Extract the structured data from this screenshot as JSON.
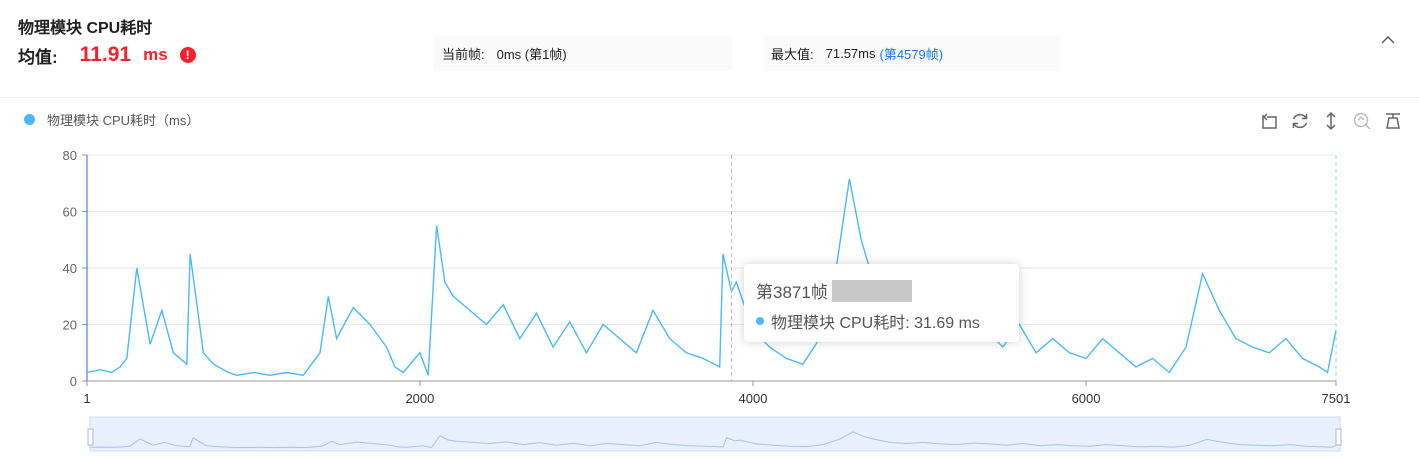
{
  "header": {
    "title": "物理模块 CPU耗时",
    "avg_label": "均值:",
    "avg_value": "11.91",
    "avg_unit": "ms",
    "warn_glyph": "!",
    "current_label": "当前帧:",
    "current_value": "0ms (第1帧)",
    "max_label": "最大值:",
    "max_value": "71.57ms",
    "max_link": "(第4579帧)"
  },
  "colors": {
    "series": "#4db8ff",
    "alert": "#f5222d",
    "link": "#1677ff"
  },
  "icons": [
    "chevron-up-icon",
    "restore-icon",
    "refresh-icon",
    "vertical-arrows-icon",
    "zoom-reset-icon",
    "brush-icon"
  ],
  "tooltip": {
    "title": "第3871帧",
    "series_text": "物理模块 CPU耗时: 31.69 ms"
  },
  "chart_data": {
    "type": "line",
    "legend": "物理模块 CPU耗时（ms）",
    "legend_position": "top-left",
    "xlim": [
      1,
      7501
    ],
    "ylim": [
      0,
      80
    ],
    "x_ticks": [
      "1",
      "2000",
      "4000",
      "6000",
      "7501"
    ],
    "y_ticks": [
      "0",
      "20",
      "40",
      "60",
      "80"
    ],
    "grid": true,
    "highlight_x": 3871,
    "data_zoom": [
      1,
      7501
    ],
    "series": [
      {
        "name": "物理模块 CPU耗时",
        "x": [
          1,
          80,
          150,
          200,
          240,
          300,
          380,
          450,
          520,
          600,
          620,
          700,
          760,
          850,
          900,
          1000,
          1100,
          1200,
          1300,
          1400,
          1450,
          1500,
          1600,
          1700,
          1800,
          1850,
          1900,
          2000,
          2050,
          2100,
          2150,
          2200,
          2300,
          2400,
          2500,
          2600,
          2700,
          2800,
          2900,
          3000,
          3100,
          3200,
          3300,
          3400,
          3500,
          3600,
          3700,
          3800,
          3820,
          3871,
          3900,
          4000,
          4100,
          4200,
          4300,
          4400,
          4500,
          4579,
          4650,
          4700,
          4800,
          4900,
          5000,
          5100,
          5200,
          5300,
          5400,
          5500,
          5600,
          5700,
          5800,
          5900,
          6000,
          6100,
          6200,
          6300,
          6400,
          6500,
          6600,
          6700,
          6800,
          6900,
          7000,
          7100,
          7200,
          7300,
          7400,
          7450,
          7501
        ],
        "values": [
          3,
          4,
          3,
          5,
          8,
          40,
          13,
          25,
          10,
          6,
          45,
          10,
          6,
          3,
          2,
          3,
          2,
          3,
          2,
          10,
          30,
          15,
          26,
          20,
          12,
          5,
          3,
          10,
          2,
          55,
          35,
          30,
          25,
          20,
          27,
          15,
          24,
          12,
          21,
          10,
          20,
          15,
          10,
          25,
          15,
          10,
          8,
          5,
          45,
          31.69,
          35,
          18,
          12,
          8,
          6,
          15,
          40,
          71.57,
          50,
          40,
          25,
          20,
          25,
          18,
          15,
          22,
          18,
          12,
          20,
          10,
          15,
          10,
          8,
          15,
          10,
          5,
          8,
          3,
          12,
          38,
          25,
          15,
          12,
          10,
          15,
          8,
          5,
          3,
          18
        ]
      }
    ]
  }
}
